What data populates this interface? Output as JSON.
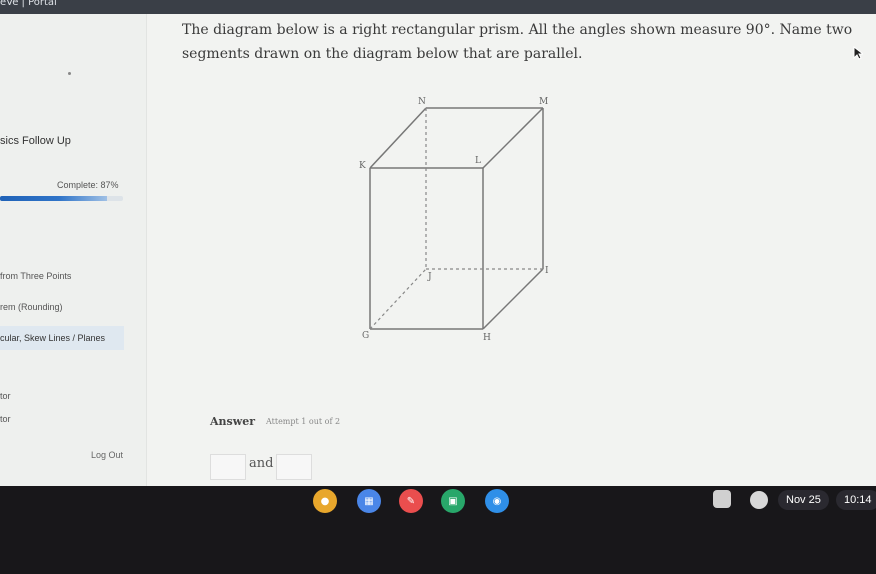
{
  "topbar": {
    "title": "eVe | Portal"
  },
  "sidebar": {
    "section_heading": "sics Follow Up",
    "complete_text": "Complete: 87%",
    "progress_fraction": 0.87,
    "items": [
      {
        "label": "from Three Points"
      },
      {
        "label": "rem (Rounding)"
      },
      {
        "label": "cular, Skew Lines / Planes",
        "active": true
      },
      {
        "label": "tor"
      },
      {
        "label": "tor"
      }
    ],
    "logout_label": "Log Out"
  },
  "question": {
    "text": "The diagram below is a right rectangular prism. All the angles shown measure 90°. Name two segments drawn on the diagram below that are parallel."
  },
  "diagram": {
    "labels": {
      "N": "N",
      "M": "M",
      "K": "K",
      "L": "L",
      "J": "J",
      "I": "I",
      "G": "G",
      "H": "H"
    }
  },
  "answer": {
    "label": "Answer",
    "attempt": "Attempt 1 out of 2",
    "connector": "and"
  },
  "taskbar": {
    "apps": [
      {
        "name": "chrome-icon",
        "color": "#e8a72c"
      },
      {
        "name": "calendar-icon",
        "color": "#4a86e8"
      },
      {
        "name": "paint-icon",
        "color": "#ea4e4e"
      },
      {
        "name": "classroom-icon",
        "color": "#28a76a"
      },
      {
        "name": "camera-icon",
        "color": "#2f8fe8"
      }
    ],
    "date": "Nov 25",
    "time": "10:14"
  }
}
